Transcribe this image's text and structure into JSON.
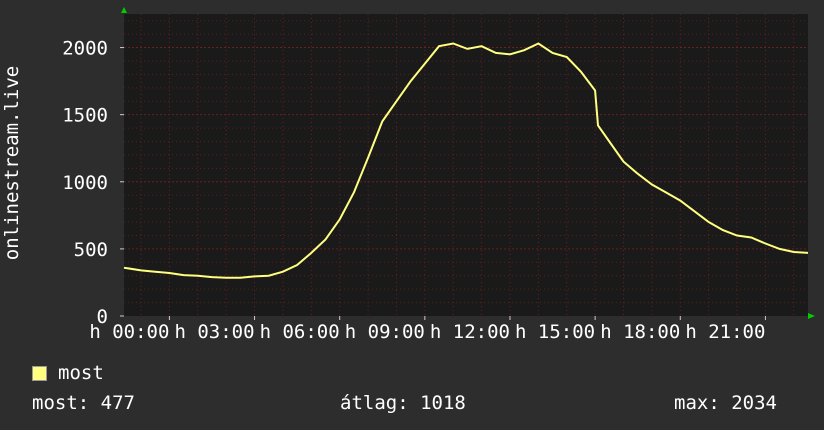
{
  "chart_data": {
    "type": "line",
    "ylabel": "onlinestream.live",
    "ylim": [
      0,
      2250
    ],
    "yticks": [
      0,
      500,
      1000,
      1500,
      2000
    ],
    "xlim_hours": [
      -1.6,
      22.5
    ],
    "xticks": [
      {
        "hour": 0,
        "label": "h 00:00"
      },
      {
        "hour": 3,
        "label": "h 03:00"
      },
      {
        "hour": 6,
        "label": "h 06:00"
      },
      {
        "hour": 9,
        "label": "h 09:00"
      },
      {
        "hour": 12,
        "label": "h 12:00"
      },
      {
        "hour": 15,
        "label": "h 15:00"
      },
      {
        "hour": 18,
        "label": "h 18:00"
      },
      {
        "hour": 21,
        "label": "h 21:00"
      }
    ],
    "grid": true,
    "colors": {
      "background": "#2d2d2d",
      "plot": "#1a1a1a",
      "grid": "#6b1f1f",
      "line": "#ffff80",
      "arrow": "#00cc00"
    },
    "series": [
      {
        "name": "most",
        "color": "#ffff80",
        "x": [
          -1.6,
          -1.0,
          -0.5,
          0.0,
          0.5,
          1.0,
          1.5,
          2.0,
          2.5,
          3.0,
          3.5,
          4.0,
          4.5,
          5.0,
          5.5,
          6.0,
          6.5,
          7.0,
          7.5,
          8.0,
          8.5,
          9.0,
          9.5,
          10.0,
          10.5,
          11.0,
          11.5,
          12.0,
          12.5,
          13.0,
          13.5,
          14.0,
          14.5,
          15.0,
          15.1,
          15.5,
          16.0,
          16.5,
          17.0,
          17.5,
          18.0,
          18.5,
          19.0,
          19.5,
          20.0,
          20.5,
          21.0,
          21.5,
          22.0,
          22.5
        ],
        "y": [
          360,
          340,
          330,
          320,
          305,
          300,
          290,
          285,
          285,
          295,
          300,
          330,
          380,
          470,
          570,
          720,
          920,
          1180,
          1450,
          1600,
          1750,
          1880,
          2010,
          2030,
          1990,
          2010,
          1960,
          1950,
          1980,
          2030,
          1960,
          1930,
          1820,
          1680,
          1420,
          1300,
          1150,
          1060,
          980,
          920,
          860,
          780,
          700,
          640,
          600,
          585,
          540,
          500,
          477,
          470
        ]
      }
    ],
    "legend": {
      "label": "most",
      "position": "bottom-left"
    },
    "stats": {
      "now": "most: 477",
      "avg": "átlag: 1018",
      "max": "max: 2034"
    }
  }
}
